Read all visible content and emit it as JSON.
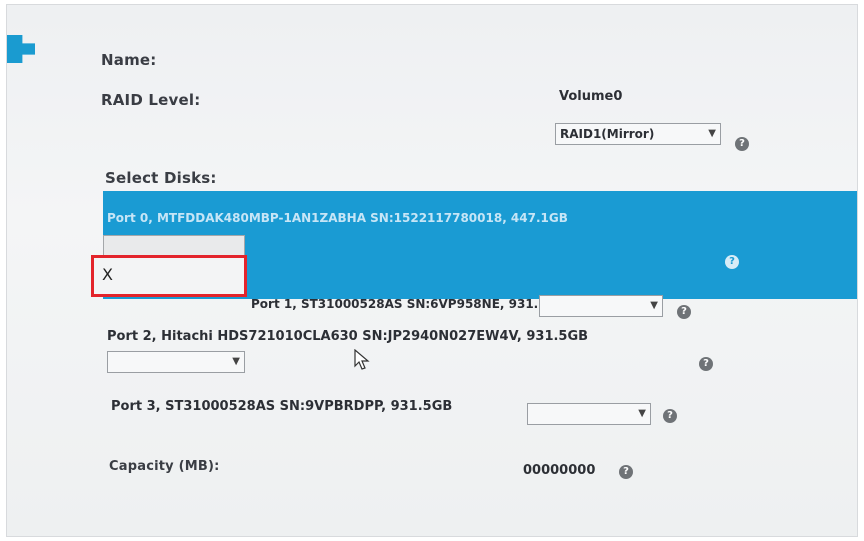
{
  "labels": {
    "name": "Name:",
    "raid_level": "RAID Level:",
    "select_disks": "Select Disks:",
    "capacity": "Capacity (MB):"
  },
  "volume": {
    "name_value": "Volume0",
    "raid_level_value": "RAID1(Mirror)"
  },
  "disks": [
    {
      "label": "Port 0, MTFDDAK480MBP-1AN1ZABHA SN:1522117780018, 447.1GB",
      "selected": ""
    },
    {
      "label": "Port 1, ST31000528AS SN:6VP958NE, 931.5GB",
      "selected": ""
    },
    {
      "label": "Port 2, Hitachi HDS721010CLA630 SN:JP2940N027EW4V, 931.5GB",
      "selected": ""
    },
    {
      "label": "Port 3, ST31000528AS SN:9VPBRDPP, 931.5GB",
      "selected": ""
    }
  ],
  "dropdown": {
    "option_x": "X"
  },
  "capacity_value": "00000000",
  "icons": {
    "help": "?",
    "arrow": "▼"
  },
  "colors": {
    "highlight": "#1a9bd3",
    "annotation": "#e3242b"
  }
}
